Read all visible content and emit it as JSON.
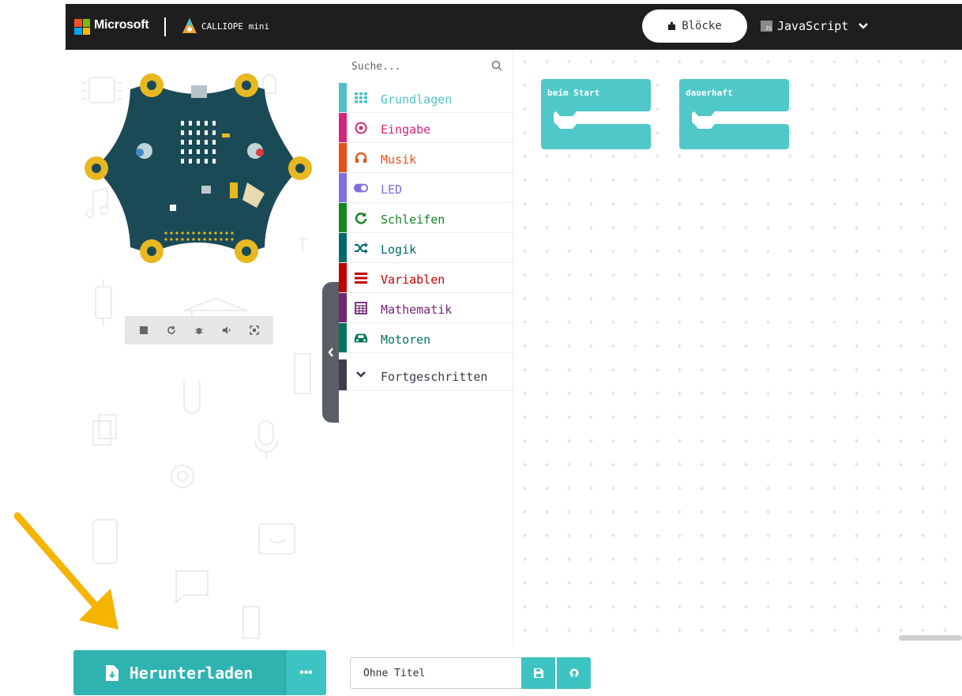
{
  "header": {
    "brand_label": "Microsoft",
    "product_label": "CALLIOPE mini",
    "blocks_tab_label": "Blöcke",
    "js_tab_label": "JavaScript",
    "js_badge": "JS"
  },
  "toolbox": {
    "search_placeholder": "Suche...",
    "categories": [
      {
        "label": "Grundlagen",
        "color": "#4fc1c8",
        "icon": "grid-icon"
      },
      {
        "label": "Eingabe",
        "color": "#d1267b",
        "icon": "target-icon"
      },
      {
        "label": "Musik",
        "color": "#e8501a",
        "icon": "headphones-icon"
      },
      {
        "label": "LED",
        "color": "#7f6fe0",
        "icon": "toggle-icon"
      },
      {
        "label": "Schleifen",
        "color": "#138521",
        "icon": "refresh-icon"
      },
      {
        "label": "Logik",
        "color": "#006970",
        "icon": "shuffle-icon"
      },
      {
        "label": "Variablen",
        "color": "#c20000",
        "icon": "lines-icon"
      },
      {
        "label": "Mathematik",
        "color": "#712672",
        "icon": "calculator-icon"
      },
      {
        "label": "Motoren",
        "color": "#00755e",
        "icon": "car-icon"
      }
    ],
    "advanced_label": "Fortgeschritten",
    "advanced_color": "#3c3c4d"
  },
  "workspace": {
    "blocks": [
      {
        "label": "beim Start",
        "color": "#4fc8c9"
      },
      {
        "label": "dauerhaft",
        "color": "#4fc8c9"
      }
    ]
  },
  "footer": {
    "download_label": "Herunterladen",
    "more_label": "•••",
    "project_name": "Ohne Titel",
    "accent": "#2fb3b1"
  },
  "colors": {
    "header_bg": "#1e1e1e",
    "arrow": "#f5b400"
  }
}
